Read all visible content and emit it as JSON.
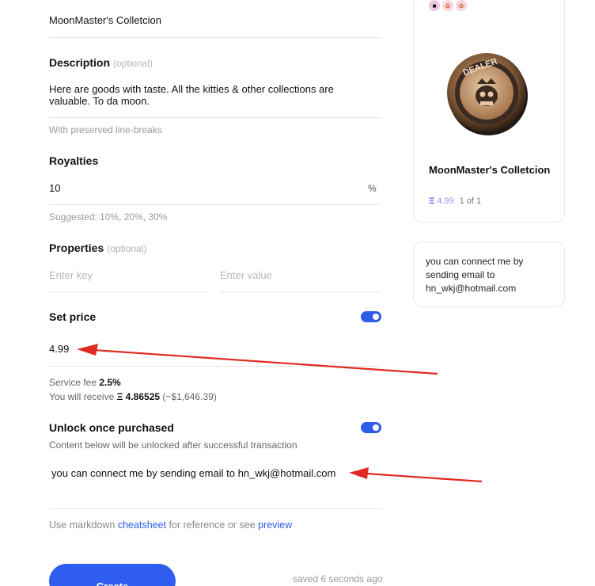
{
  "form": {
    "name_value": "MoonMaster's Colletcion",
    "description": {
      "label": "Description",
      "optional": "(optional)",
      "value_line1": "Here  are goods with taste. All the kitties & other collections are",
      "value_line2": "valuable. To da moon.",
      "hint": "With preserved line-breaks"
    },
    "royalties": {
      "label": "Royalties",
      "value": "10",
      "unit": "%",
      "hint": "Suggested: 10%, 20%, 30%"
    },
    "properties": {
      "label": "Properties",
      "optional": "(optional)",
      "key_placeholder": "Enter key",
      "value_placeholder": "Enter value"
    },
    "set_price": {
      "label": "Set price",
      "enabled": true,
      "value": "4.99",
      "fee_label": "Service fee",
      "fee_value": "2.5%",
      "receive_label": "You will receive",
      "receive_value": "Ξ 4.86525",
      "receive_usd": "(~$1,646.39)"
    },
    "unlock": {
      "label": "Unlock once purchased",
      "enabled": true,
      "subtitle": "Content below will be unlocked after successful transaction",
      "content": "you can connect me by sending email to hn_wkj@hotmail.com"
    },
    "markdown_hint": {
      "prefix": "Use markdown",
      "link1": "cheatsheet",
      "middle": "for reference or see",
      "link2": "preview"
    },
    "create_label": "Create",
    "saved_status": "saved 6 seconds ago"
  },
  "preview": {
    "title": "MoonMaster's Colletcion",
    "eth_symbol": "Ξ",
    "price": "4.99",
    "count": "1 of 1",
    "image_icon": "dealer-coin-image"
  },
  "message_card": {
    "text": "you can connect me by sending email to hn_wkj@hotmail.com"
  },
  "colors": {
    "accent": "#2d5de8",
    "annotation_arrow": "#e02b22"
  }
}
